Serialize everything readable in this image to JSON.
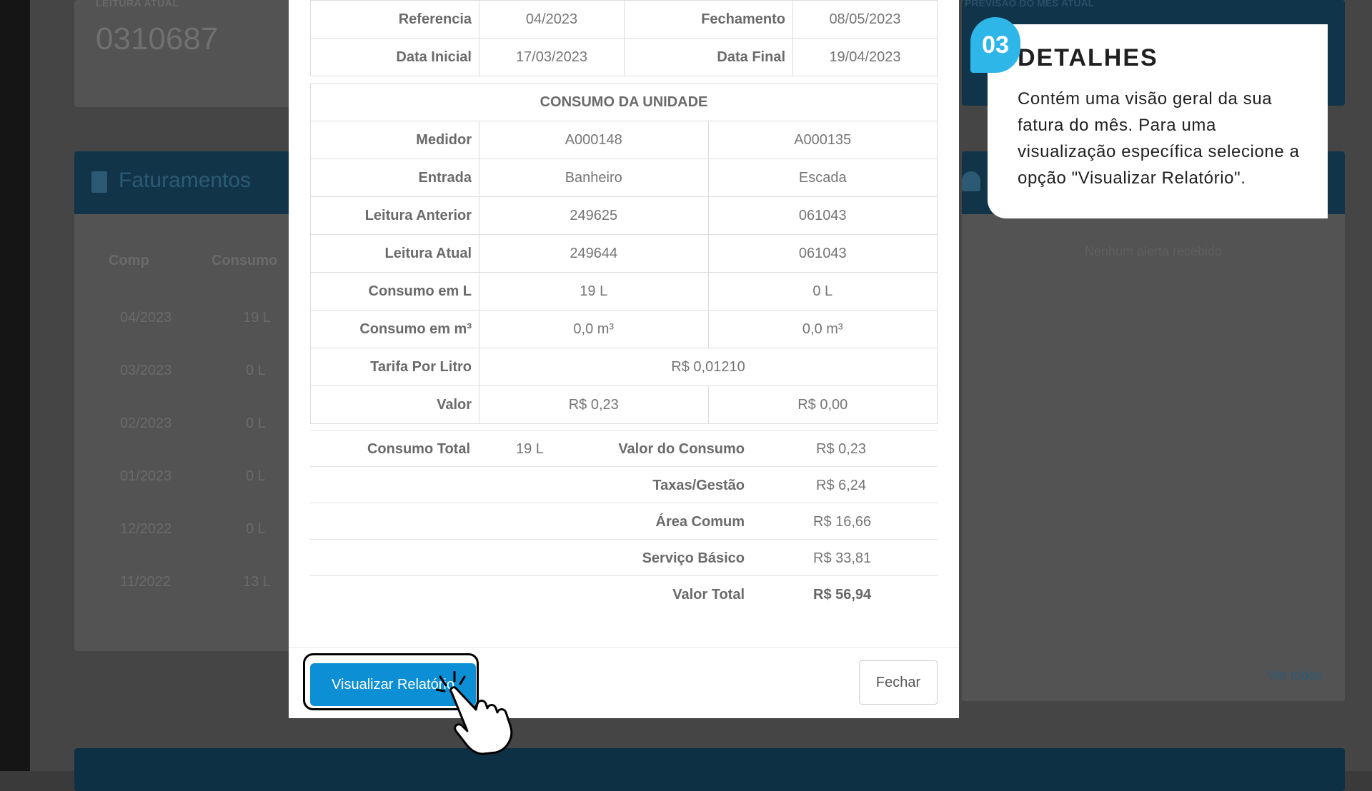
{
  "background": {
    "reading_label": "LEITURA ATUAL",
    "reading_value": "0310687",
    "forecast_label": "PREVISÃO DO MÊS ATUAL",
    "billing_title": "Faturamentos",
    "billing_columns": [
      "Comp",
      "Consumo"
    ],
    "billing_rows": [
      {
        "comp": "04/2023",
        "consumo": "19 L"
      },
      {
        "comp": "03/2023",
        "consumo": "0 L"
      },
      {
        "comp": "02/2023",
        "consumo": "0 L"
      },
      {
        "comp": "01/2023",
        "consumo": "0 L"
      },
      {
        "comp": "12/2022",
        "consumo": "0 L"
      },
      {
        "comp": "11/2022",
        "consumo": "13 L"
      }
    ],
    "no_alerts": "Nenhum alerta recebido",
    "see_all": "Ver todos"
  },
  "modal": {
    "info": {
      "referencia_label": "Referencia",
      "referencia_value": "04/2023",
      "fechamento_label": "Fechamento",
      "fechamento_value": "08/05/2023",
      "data_inicial_label": "Data Inicial",
      "data_inicial_value": "17/03/2023",
      "data_final_label": "Data Final",
      "data_final_value": "19/04/2023"
    },
    "consumption": {
      "title": "CONSUMO DA UNIDADE",
      "rows": [
        {
          "label": "Medidor",
          "a": "A000148",
          "b": "A000135"
        },
        {
          "label": "Entrada",
          "a": "Banheiro",
          "b": "Escada"
        },
        {
          "label": "Leitura Anterior",
          "a": "249625",
          "b": "061043"
        },
        {
          "label": "Leitura Atual",
          "a": "249644",
          "b": "061043"
        },
        {
          "label": "Consumo em L",
          "a": "19 L",
          "b": "0 L"
        },
        {
          "label": "Consumo em m³",
          "a": "0,0 m³",
          "b": "0,0 m³"
        }
      ],
      "tarifa_label": "Tarifa Por Litro",
      "tarifa_value": "R$ 0,01210",
      "valor_label": "Valor",
      "valor_a": "R$ 0,23",
      "valor_b": "R$ 0,00"
    },
    "summary": {
      "consumo_total_label": "Consumo Total",
      "consumo_total_value": "19 L",
      "valor_consumo_label": "Valor do Consumo",
      "valor_consumo_value": "R$ 0,23",
      "taxas_label": "Taxas/Gestão",
      "taxas_value": "R$ 6,24",
      "area_label": "Área Comum",
      "area_value": "R$ 16,66",
      "servico_label": "Serviço Básico",
      "servico_value": "R$ 33,81",
      "total_label": "Valor Total",
      "total_value": "R$ 56,94"
    },
    "buttons": {
      "report": "Visualizar Relatório",
      "close": "Fechar"
    }
  },
  "callout": {
    "number": "03",
    "title": "DETALHES",
    "text": "Contém uma visão geral da sua fatura do mês. Para uma visualização específica selecione a opção \"Visualizar Relatório\"."
  },
  "colors": {
    "accent": "#0d8fd6",
    "badge": "#2fb6e8",
    "header_dark": "#123449"
  }
}
